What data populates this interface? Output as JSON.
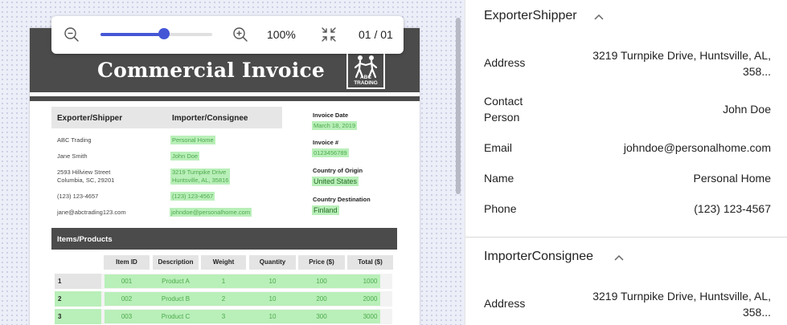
{
  "document": {
    "title": "Commercial Invoice",
    "logo_text": "ABC TRADING",
    "exporter_header": "Exporter/Shipper",
    "importer_header": "Importer/Consignee",
    "exporter": {
      "company": "ABC Trading",
      "name": "Jane Smith",
      "address_line1": "2593 Hillview Street",
      "address_line2": "Columbia, SC, 29201",
      "phone": "(123) 123-4657",
      "email": "jane@abctrading123.com"
    },
    "importer": {
      "company": "Personal Home",
      "name": "John Doe",
      "address_line1": "3219 Turnpike Drive",
      "address_line2": "Huntsville, AL, 35816",
      "phone": "(123) 123-4567",
      "email": "johndoe@personalhome.com"
    },
    "invoice_date_label": "Invoice Date",
    "invoice_date": "March 18, 2019",
    "invoice_number_label": "Invoice #",
    "invoice_number": "0123456789",
    "country_origin_label": "Country of Origin",
    "country_origin": "United States",
    "country_destination_label": "Country Destination",
    "country_destination": "Finland",
    "items_title": "Items/Products",
    "table_headers": [
      "Item ID",
      "Description",
      "Weight",
      "Quantity",
      "Price ($)",
      "Total ($)"
    ],
    "rows": [
      {
        "num": "1",
        "cells": [
          "001",
          "Product A",
          "1",
          "10",
          "100",
          "1000"
        ]
      },
      {
        "num": "2",
        "cells": [
          "002",
          "Product B",
          "2",
          "10",
          "200",
          "2000"
        ]
      },
      {
        "num": "3",
        "cells": [
          "003",
          "Product C",
          "3",
          "10",
          "300",
          "3000"
        ]
      }
    ]
  },
  "toolbar": {
    "zoom_out_icon": "zoom-out-icon",
    "zoom_in_icon": "zoom-in-icon",
    "fit_icon": "collapse-icon",
    "zoom_level": "100%",
    "zoom_slider_fraction": 0.57,
    "page_indicator": "01 / 01"
  },
  "panel": {
    "exporter_section": {
      "title": "ExporterShipper",
      "fields": [
        {
          "label": "Address",
          "value_line1": "3219 Turnpike Drive, Huntsville, AL,",
          "value_line2": "358..."
        },
        {
          "label_line1": "Contact",
          "label_line2": "Person",
          "value": "John Doe"
        },
        {
          "label": "Email",
          "value": "johndoe@personalhome.com"
        },
        {
          "label": "Name",
          "value": "Personal Home"
        },
        {
          "label": "Phone",
          "value": "(123) 123-4567"
        }
      ]
    },
    "importer_section": {
      "title": "ImporterConsignee",
      "fields": [
        {
          "label": "Address",
          "value_line1": "3219 Turnpike Drive, Huntsville, AL,",
          "value_line2": "358..."
        }
      ]
    }
  },
  "colors": {
    "accent": "#4456d6",
    "highlight": "#b9efb9",
    "header_dark": "#4b4b4b"
  }
}
